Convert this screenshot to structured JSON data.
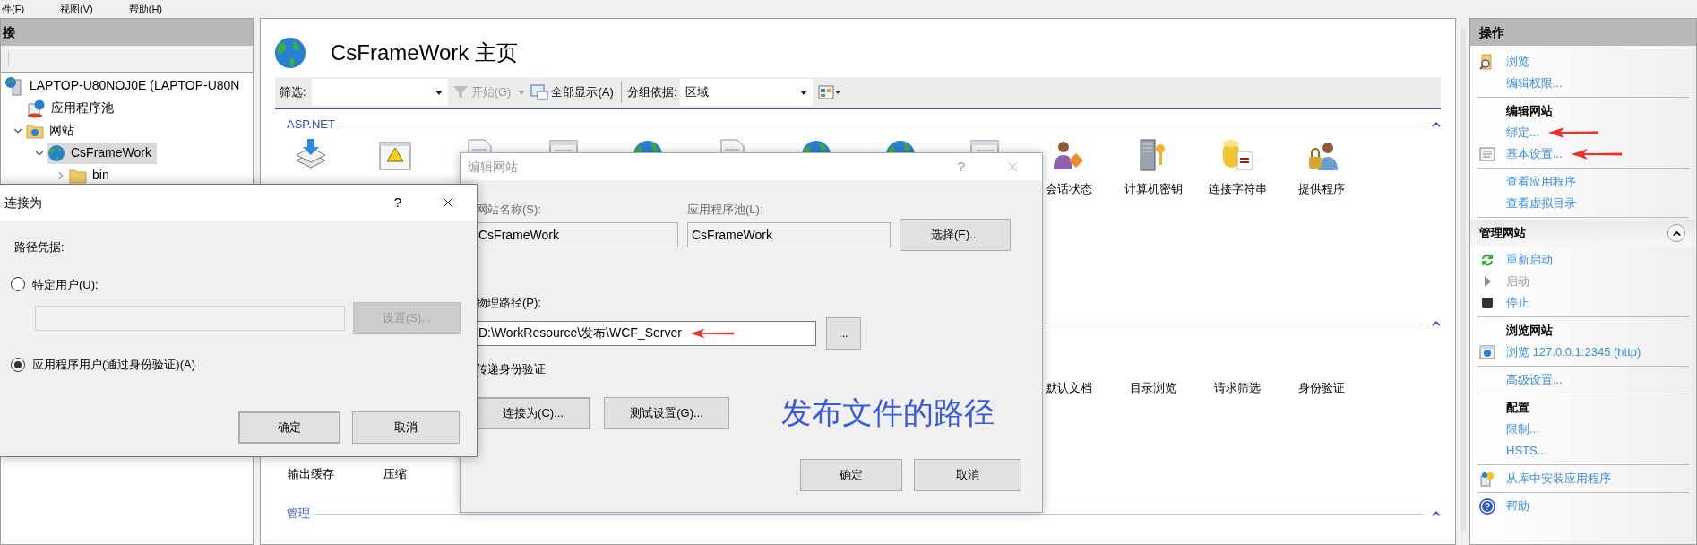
{
  "menu_bar": [
    "件(F)",
    "视图(V)",
    "帮助(H)"
  ],
  "connections": {
    "title": "接",
    "tree": [
      {
        "label": "LAPTOP-U80NOJ0E (LAPTOP-U80N",
        "selected": false,
        "children": [
          {
            "label": "应用程序池",
            "selected": false
          },
          {
            "label": "网站",
            "selected": false,
            "expanded": true,
            "children": [
              {
                "label": "CsFrameWork",
                "selected": true,
                "expanded": true,
                "children": [
                  {
                    "label": "bin",
                    "selected": false,
                    "expanded": false
                  }
                ]
              }
            ]
          }
        ]
      }
    ]
  },
  "page": {
    "title": "CsFrameWork 主页",
    "toolbar": {
      "filter_label": "筛选:",
      "start_button": {
        "label": "开始(G)",
        "disabled": true
      },
      "show_all_button": "全部显示(A)",
      "group_by_label": "分组依据:",
      "group_by_value": "区域"
    },
    "groups": [
      {
        "title": "ASP.NET",
        "rows": [
          [
            {
              "kind": "icon"
            },
            {
              "kind": "icon"
            },
            {
              "kind": "icon"
            },
            {
              "kind": "icon"
            },
            {
              "kind": "icon"
            },
            {
              "kind": "icon"
            },
            {
              "kind": "icon"
            },
            {
              "kind": "icon"
            },
            {
              "kind": "icon"
            },
            {
              "kind": "feature",
              "label": "会话状态"
            },
            {
              "kind": "feature",
              "label": "计算机密钥"
            },
            {
              "kind": "feature",
              "label": "连接字符串"
            },
            {
              "kind": "feature",
              "label": "提供程序"
            }
          ]
        ]
      },
      {
        "rows": [
          [
            {
              "kind": "covered"
            },
            {
              "kind": "covered"
            },
            {
              "kind": "covered"
            },
            {
              "kind": "covered"
            },
            {
              "kind": "covered"
            },
            {
              "kind": "covered"
            },
            {
              "kind": "covered"
            },
            {
              "kind": "covered"
            },
            {
              "kind": "covered"
            },
            {
              "kind": "feature",
              "label": "默认文档"
            },
            {
              "kind": "feature",
              "label": "目录浏览"
            },
            {
              "kind": "feature",
              "label": "请求筛选"
            },
            {
              "kind": "feature",
              "label": "身份验证"
            }
          ],
          [
            {
              "kind": "text",
              "label": "输出缓存"
            },
            {
              "kind": "text",
              "label": "压缩"
            }
          ]
        ]
      },
      {
        "title": "管理"
      }
    ]
  },
  "edit_site_dialog": {
    "title": "编辑网站",
    "active": false,
    "help": "?",
    "site_name_label": "网站名称(S):",
    "site_name": "CsFrameWork",
    "pool_label": "应用程序池(L):",
    "pool": "CsFrameWork",
    "select_button": "选择(E)...",
    "path_label": "物理路径(P):",
    "path": "D:\\WorkResource\\发布\\WCF_Server",
    "path_pointer_arrow": true,
    "browse_button": "...",
    "pass_through_label": "传递身份验证",
    "connect_as_button": "连接为(C)...",
    "test_button": "测试设置(G)...",
    "annotation": "发布文件的路径",
    "ok_button": "确定",
    "cancel_button": "取消"
  },
  "connect_as_dialog": {
    "title": "连接为",
    "help": "?",
    "group_label": "路径凭据:",
    "options": [
      {
        "label": "特定用户(U):",
        "selected": false
      },
      {
        "label": "应用程序用户(通过身份验证)(A)",
        "selected": true
      }
    ],
    "set_button": {
      "label": "设置(S)...",
      "disabled": true
    },
    "ok_button": "确定",
    "cancel_button": "取消"
  },
  "actions": {
    "title": "操作",
    "sections": [
      {
        "groups": [
          [
            {
              "kind": "link",
              "label": "浏览",
              "disabled": false,
              "pointer_arrow": false
            },
            {
              "kind": "link",
              "label": "编辑权限...",
              "disabled": false,
              "pointer_arrow": false
            }
          ],
          [
            {
              "kind": "heading",
              "label": "编辑网站"
            },
            {
              "kind": "link",
              "label": "绑定...",
              "disabled": false,
              "pointer_arrow": true
            },
            {
              "kind": "link",
              "label": "基本设置...",
              "disabled": false,
              "pointer_arrow": true
            }
          ],
          [
            {
              "kind": "link",
              "label": "查看应用程序",
              "disabled": false,
              "pointer_arrow": false
            },
            {
              "kind": "link",
              "label": "查看虚拟目录",
              "disabled": false,
              "pointer_arrow": false
            }
          ]
        ]
      },
      {
        "title": "管理网站",
        "expanded": true,
        "groups": [
          [
            {
              "kind": "link",
              "label": "重新启动",
              "disabled": false,
              "pointer_arrow": false
            },
            {
              "kind": "link",
              "label": "启动",
              "disabled": true,
              "pointer_arrow": false
            },
            {
              "kind": "link",
              "label": "停止",
              "disabled": false,
              "pointer_arrow": false
            }
          ],
          [
            {
              "kind": "heading",
              "label": "浏览网站"
            },
            {
              "kind": "link",
              "label": "浏览 127.0.0.1:2345 (http)",
              "disabled": false,
              "pointer_arrow": false
            }
          ],
          [
            {
              "kind": "link",
              "label": "高级设置...",
              "disabled": false,
              "pointer_arrow": false
            }
          ],
          [
            {
              "kind": "heading",
              "label": "配置"
            },
            {
              "kind": "link",
              "label": "限制...",
              "disabled": false,
              "pointer_arrow": false
            },
            {
              "kind": "link",
              "label": "HSTS...",
              "disabled": false,
              "pointer_arrow": false
            }
          ],
          [
            {
              "kind": "link",
              "label": "从库中安装应用程序",
              "disabled": false,
              "pointer_arrow": false
            }
          ],
          [
            {
              "kind": "link",
              "label": "帮助",
              "disabled": false,
              "pointer_arrow": false
            }
          ]
        ]
      }
    ]
  }
}
